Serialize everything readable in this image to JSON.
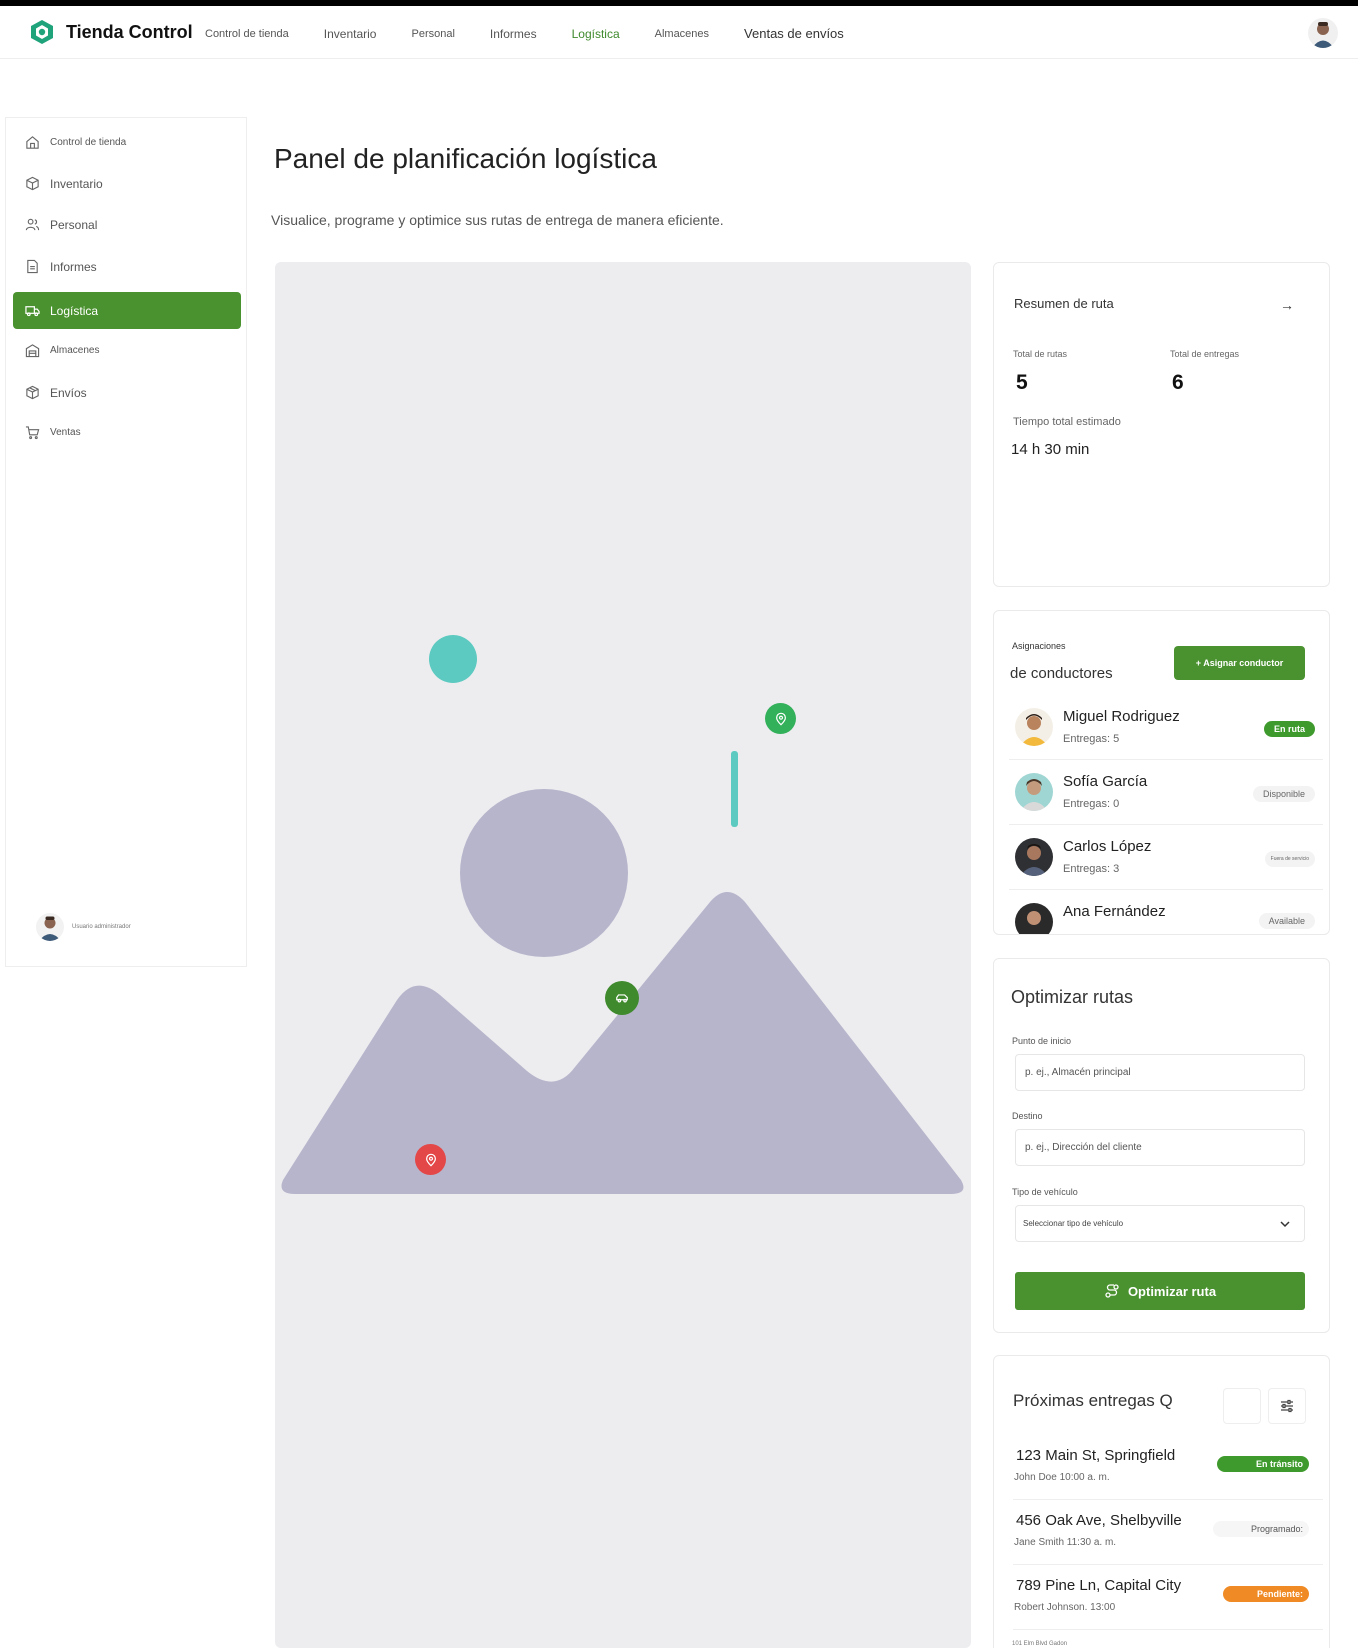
{
  "app": {
    "name": "Tienda Control"
  },
  "topnav": [
    {
      "label": "Control de tienda"
    },
    {
      "label": "Inventario"
    },
    {
      "label": "Personal"
    },
    {
      "label": "Informes"
    },
    {
      "label": "Logística",
      "active": true
    },
    {
      "label": "Almacenes"
    },
    {
      "label": "Ventas de envíos"
    }
  ],
  "sidebar": {
    "items": [
      {
        "label": "Control de tienda",
        "icon": "home-icon"
      },
      {
        "label": "Inventario",
        "icon": "box-icon"
      },
      {
        "label": "Personal",
        "icon": "users-icon"
      },
      {
        "label": "Informes",
        "icon": "file-icon"
      },
      {
        "label": "Logística",
        "icon": "truck-icon",
        "active": true
      },
      {
        "label": "Almacenes",
        "icon": "warehouse-icon"
      },
      {
        "label": "Envíos",
        "icon": "package-icon"
      },
      {
        "label": "Ventas",
        "icon": "cart-icon"
      }
    ],
    "user": {
      "name": "Usuario administrador"
    }
  },
  "page": {
    "title": "Panel de planificación logística",
    "subtitle": "Visualice, programe y optimice sus rutas de entrega de manera eficiente."
  },
  "route_summary": {
    "title": "Resumen de ruta",
    "total_routes_label": "Total de rutas",
    "total_routes": "5",
    "total_deliveries_label": "Total de entregas",
    "total_deliveries": "6",
    "est_time_label": "Tiempo total estimado",
    "est_time": "14 h 30 min"
  },
  "assignments": {
    "title_line1": "Asignaciones",
    "title_line2": "de conductores",
    "assign_button": "+ Asignar conductor",
    "drivers": [
      {
        "name": "Miguel Rodriguez",
        "deliveries": "Entregas: 5",
        "status": "En ruta"
      },
      {
        "name": "Sofía García",
        "deliveries": "Entregas: 0",
        "status": "Disponible"
      },
      {
        "name": "Carlos López",
        "deliveries": "Entregas: 3",
        "status": "Fuera de servicio"
      },
      {
        "name": "Ana Fernández",
        "deliveries": "",
        "status": "Available"
      }
    ]
  },
  "optimize": {
    "title": "Optimizar rutas",
    "start_label": "Punto de inicio",
    "start_placeholder": "p. ej., Almacén principal",
    "dest_label": "Destino",
    "dest_placeholder": "p. ej., Dirección del cliente",
    "vehicle_label": "Tipo de vehículo",
    "vehicle_placeholder": "Seleccionar tipo de vehículo",
    "button": "Optimizar ruta"
  },
  "upcoming": {
    "title": "Próximas entregas Q",
    "items": [
      {
        "address": "123 Main St, Springfield",
        "meta": "John Doe 10:00 a. m.",
        "status": "En tránsito"
      },
      {
        "address": "456 Oak Ave, Shelbyville",
        "meta": "Jane Smith 11:30 a. m.",
        "status": "Programado:"
      },
      {
        "address": "789 Pine Ln, Capital City",
        "meta": "Robert Johnson. 13:00",
        "status": "Pendiente:"
      }
    ],
    "partial_item": "101 Elm Blvd Gadon"
  },
  "colors": {
    "accent": "#4a922f",
    "teal": "#5ccac0",
    "placeholder": "#b7b5cb",
    "danger": "#e44747",
    "warning": "#f08a24"
  }
}
